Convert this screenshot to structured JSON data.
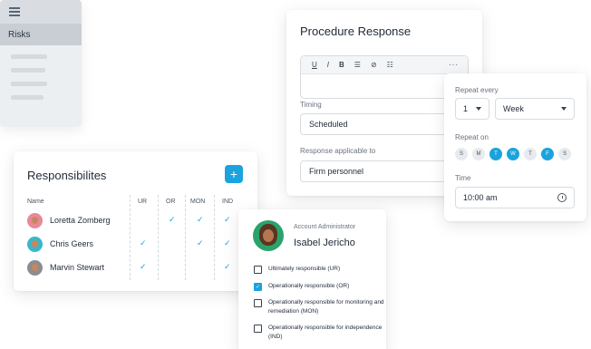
{
  "risks": {
    "label": "Risks"
  },
  "procedure": {
    "title": "Procedure Response",
    "toolbar": [
      "U",
      "I",
      "B",
      "☰",
      "⊘",
      "☷",
      "···"
    ],
    "timing_label": "Timing",
    "timing_value": "Scheduled",
    "applicable_label": "Response applicable to",
    "applicable_value": "Firm personnel"
  },
  "repeat": {
    "every_label": "Repeat every",
    "every_value": "1",
    "unit_value": "Week",
    "on_label": "Repeat on",
    "days": [
      {
        "l": "S",
        "on": false
      },
      {
        "l": "M",
        "on": false
      },
      {
        "l": "T",
        "on": true
      },
      {
        "l": "W",
        "on": true
      },
      {
        "l": "T",
        "on": false
      },
      {
        "l": "F",
        "on": true
      },
      {
        "l": "S",
        "on": false
      }
    ],
    "time_label": "Time",
    "time_value": "10:00 am"
  },
  "responsibilities": {
    "title": "Responsibilites",
    "add_label": "+",
    "headers": [
      "Name",
      "UR",
      "OR",
      "MON",
      "IND"
    ],
    "check_glyph": "✓",
    "rows": [
      {
        "name": "Loretta Zomberg",
        "checks": [
          false,
          true,
          true,
          true
        ],
        "avatar_color": "#e8889a"
      },
      {
        "name": "Chris Geers",
        "checks": [
          true,
          false,
          true,
          true
        ],
        "avatar_color": "#3bb6c9"
      },
      {
        "name": "Marvin Stewart",
        "checks": [
          true,
          false,
          false,
          true
        ],
        "avatar_color": "#8a8d92"
      }
    ]
  },
  "admin": {
    "role": "Account Administrator",
    "name": "Isabel Jericho",
    "options": [
      {
        "label": "Ultimately responsible (UR)",
        "checked": false
      },
      {
        "label": "Operationally responsible (OR)",
        "checked": true
      },
      {
        "label": "Operationally responsible for monitoring and remediation (MON)",
        "checked": false
      },
      {
        "label": "Operationally responsible for independence (IND)",
        "checked": false
      }
    ]
  }
}
